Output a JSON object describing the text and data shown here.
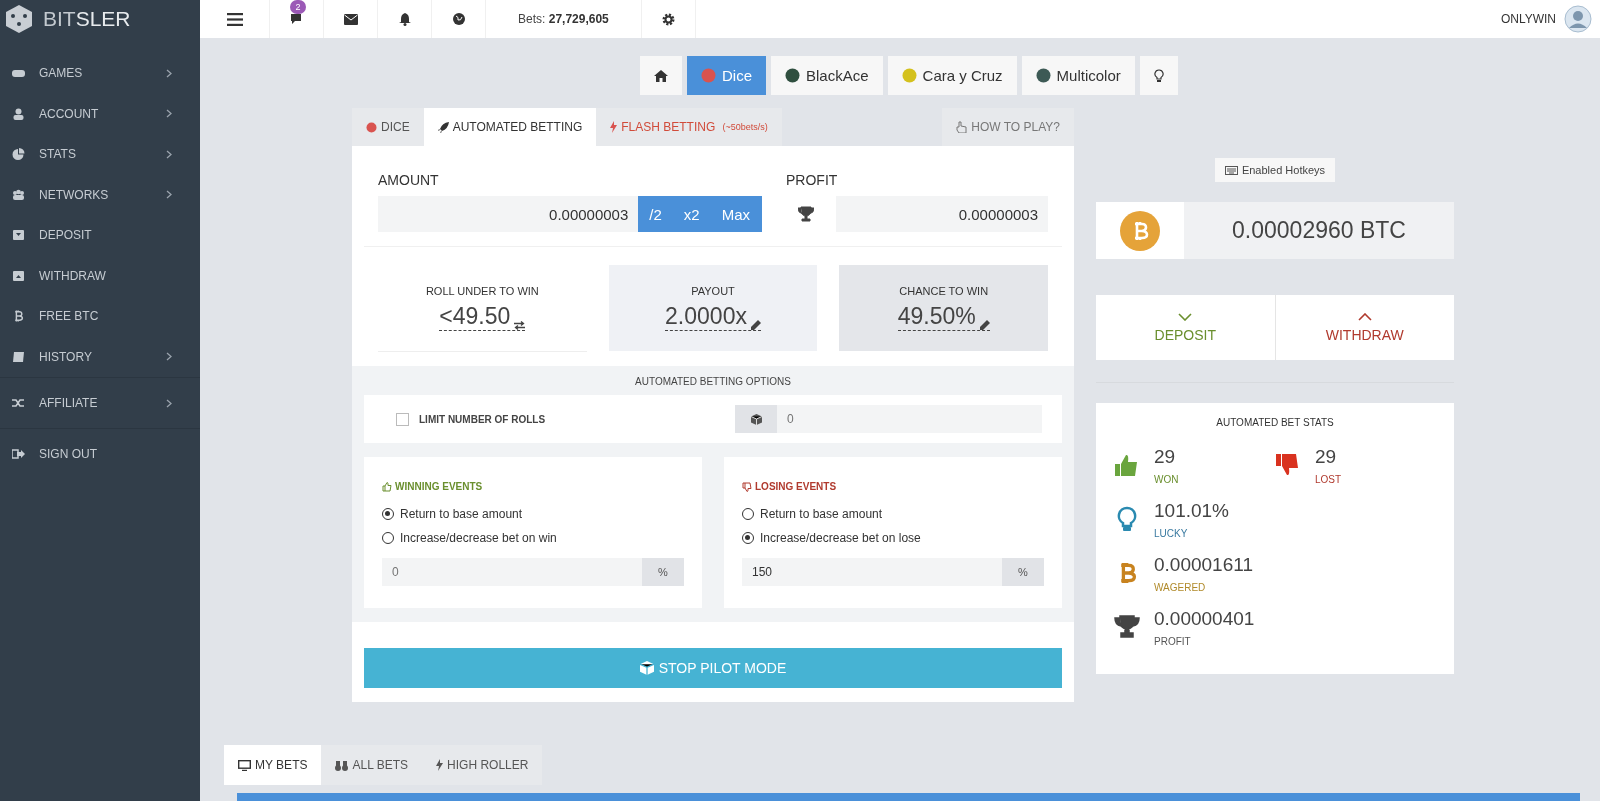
{
  "brand": {
    "name_light": "BIT",
    "name_bold": "SLER"
  },
  "sidebar": {
    "items": [
      {
        "label": "GAMES",
        "has_submenu": true
      },
      {
        "label": "ACCOUNT",
        "has_submenu": true
      },
      {
        "label": "STATS",
        "has_submenu": true
      },
      {
        "label": "NETWORKS",
        "has_submenu": true
      },
      {
        "label": "DEPOSIT",
        "has_submenu": false
      },
      {
        "label": "WITHDRAW",
        "has_submenu": false
      },
      {
        "label": "FREE BTC",
        "has_submenu": false
      },
      {
        "label": "HISTORY",
        "has_submenu": true
      },
      {
        "label": "AFFILIATE",
        "has_submenu": true
      },
      {
        "label": "SIGN OUT",
        "has_submenu": false
      }
    ]
  },
  "topbar": {
    "chat_badge": "2",
    "bets_label": "Bets:",
    "bets_value": "27,729,605",
    "username": "ONLYWIN"
  },
  "game_tabs": [
    {
      "kind": "home",
      "selected": false
    },
    {
      "kind": "game",
      "label": "Dice",
      "selected": true,
      "color": "#d9534f"
    },
    {
      "kind": "game",
      "label": "BlackAce",
      "selected": false,
      "color": "#2f4f3f"
    },
    {
      "kind": "game",
      "label": "Cara y Cruz",
      "selected": false,
      "color": "#d4c11d"
    },
    {
      "kind": "game",
      "label": "Multicolor",
      "selected": false,
      "color": "#3d5a55"
    },
    {
      "kind": "tip",
      "selected": false
    }
  ],
  "mode_tabs": [
    {
      "kind": "dice",
      "label": "DICE",
      "selected": false
    },
    {
      "kind": "auto",
      "label": "AUTOMATED BETTING",
      "selected": true
    },
    {
      "kind": "flash",
      "label": "FLASH BETTING",
      "note": "(~50bets/s)",
      "selected": false
    }
  ],
  "how_to_play": "HOW TO PLAY?",
  "amount": {
    "label": "AMOUNT",
    "value": "0.00000003",
    "buttons": [
      "/2",
      "x2",
      "Max"
    ]
  },
  "profit": {
    "label": "PROFIT",
    "value": "0.00000003"
  },
  "bet_stats": [
    {
      "kind": "roll",
      "label": "ROLL UNDER TO WIN",
      "value": "<49.50"
    },
    {
      "kind": "payout",
      "label": "PAYOUT",
      "value": "2.0000x"
    },
    {
      "kind": "chance",
      "label": "CHANCE TO WIN",
      "value": "49.50%"
    }
  ],
  "options": {
    "title": "AUTOMATED BETTING OPTIONS",
    "limit": {
      "label": "LIMIT NUMBER OF ROLLS",
      "checked": false,
      "placeholder": "0"
    }
  },
  "events": [
    {
      "kind": "win",
      "title": "WINNING EVENTS",
      "choices": [
        {
          "label": "Return to base amount",
          "selected": true
        },
        {
          "label": "Increase/decrease bet on win",
          "selected": false
        }
      ],
      "field": {
        "placeholder": "0",
        "unit": "%"
      }
    },
    {
      "kind": "lose",
      "title": "LOSING EVENTS",
      "choices": [
        {
          "label": "Return to base amount",
          "selected": false
        },
        {
          "label": "Increase/decrease bet on lose",
          "selected": true
        }
      ],
      "field": {
        "value": "150",
        "unit": "%"
      }
    }
  ],
  "stop_button": "STOP PILOT MODE",
  "hotkeys": "Enabled Hotkeys",
  "balance": "0.00002960 BTC",
  "wallet": [
    {
      "kind": "deposit",
      "label": "DEPOSIT"
    },
    {
      "kind": "withdraw",
      "label": "WITHDRAW"
    }
  ],
  "auto_stats": {
    "title": "AUTOMATED BET STATS",
    "items": [
      {
        "kind": "won",
        "value": "29",
        "label": "WON"
      },
      {
        "kind": "lost",
        "value": "29",
        "label": "LOST"
      },
      {
        "kind": "lucky",
        "value": "101.01%",
        "label": "LUCKY"
      },
      {
        "kind": "wagered",
        "value": "0.00001611",
        "label": "WAGERED"
      },
      {
        "kind": "profit",
        "value": "0.00000401",
        "label": "PROFIT"
      }
    ]
  },
  "bets_tabs": [
    {
      "kind": "monitor",
      "label": "MY BETS",
      "selected": true
    },
    {
      "kind": "binoculars",
      "label": "ALL BETS",
      "selected": false
    },
    {
      "kind": "bolt",
      "label": "HIGH ROLLER",
      "selected": false
    }
  ]
}
